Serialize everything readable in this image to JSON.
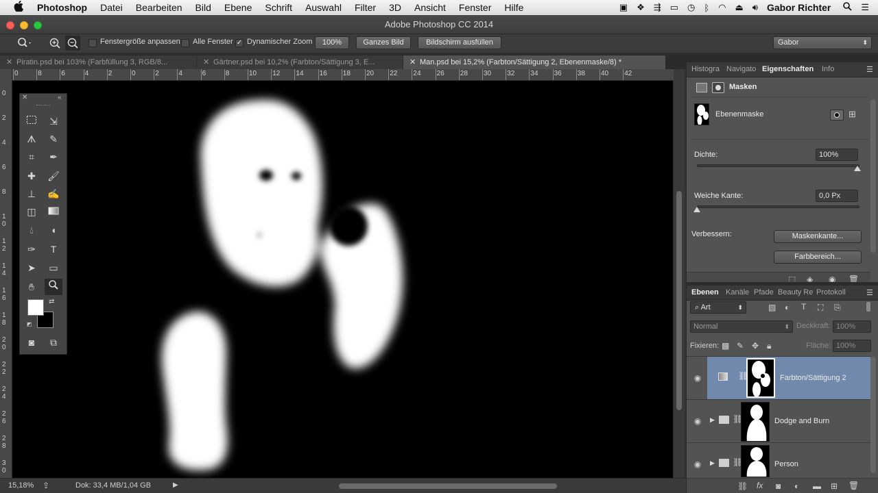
{
  "menubar": {
    "apple": "",
    "items": [
      "Photoshop",
      "Datei",
      "Bearbeiten",
      "Bild",
      "Ebene",
      "Schrift",
      "Auswahl",
      "Filter",
      "3D",
      "Ansicht",
      "Fenster",
      "Hilfe"
    ],
    "user": "Gabor Richter"
  },
  "window": {
    "title": "Adobe Photoshop CC 2014"
  },
  "options": {
    "fit_window": "Fenstergröße anpassen",
    "all_windows": "Alle Fenster",
    "dynamic_zoom": "Dynamischer Zoom",
    "dynamic_zoom_checked": "✓",
    "zoom_100": "100%",
    "fit_screen": "Ganzes Bild",
    "fill_screen": "Bildschirm ausfüllen",
    "workspace": "Gabor"
  },
  "doc_tabs": [
    {
      "label": "Piratin.psd bei 103% (Farbfüllung 3, RGB/8..."
    },
    {
      "label": "Gärtner.psd bei 10,2% (Farbton/Sättigung 3, E..."
    },
    {
      "label": "Man.psd bei 15,2% (Farbton/Sättigung 2, Ebenenmaske/8) *"
    }
  ],
  "ruler_top": [
    "0",
    "8",
    "6",
    "4",
    "2",
    "0",
    "2",
    "4",
    "6",
    "8",
    "10",
    "12",
    "14",
    "16",
    "18",
    "20",
    "22",
    "24",
    "26",
    "28",
    "30",
    "32",
    "34",
    "36",
    "38",
    "40",
    "42"
  ],
  "ruler_left": [
    "0",
    "2",
    "4",
    "6",
    "8",
    "1 0",
    "1 2",
    "1 4",
    "1 6",
    "1 8",
    "2 0",
    "2 2",
    "2 4",
    "2 6",
    "2 8",
    "3 0"
  ],
  "status": {
    "zoom": "15,18%",
    "doc": "Dok: 33,4 MB/1,04 GB"
  },
  "properties_panel": {
    "tabs": [
      "Histogra",
      "Navigato",
      "Eigenschaften",
      "Info"
    ],
    "header": "Masken",
    "mask_label": "Ebenenmaske",
    "density_label": "Dichte:",
    "density_value": "100%",
    "density_percent": 100,
    "feather_label": "Weiche Kante:",
    "feather_value": "0,0 Px",
    "refine_label": "Verbessern:",
    "mask_edge_button": "Maskenkante...",
    "color_range_button": "Farbbereich..."
  },
  "layers_panel": {
    "tabs": [
      "Ebenen",
      "Kanäle",
      "Pfade",
      "Beauty Ret",
      "Protokoll"
    ],
    "filter_kind": "Art",
    "blend_mode": "Normal",
    "opacity_label": "Deckkraft:",
    "opacity_value": "100%",
    "lock_label": "Fixieren:",
    "fill_label": "Fläche:",
    "fill_value": "100%",
    "layers": [
      {
        "name": "Farbton/Sättigung 2",
        "selected": true
      },
      {
        "name": "Dodge and Burn",
        "selected": false
      },
      {
        "name": "Person",
        "selected": false
      }
    ]
  }
}
